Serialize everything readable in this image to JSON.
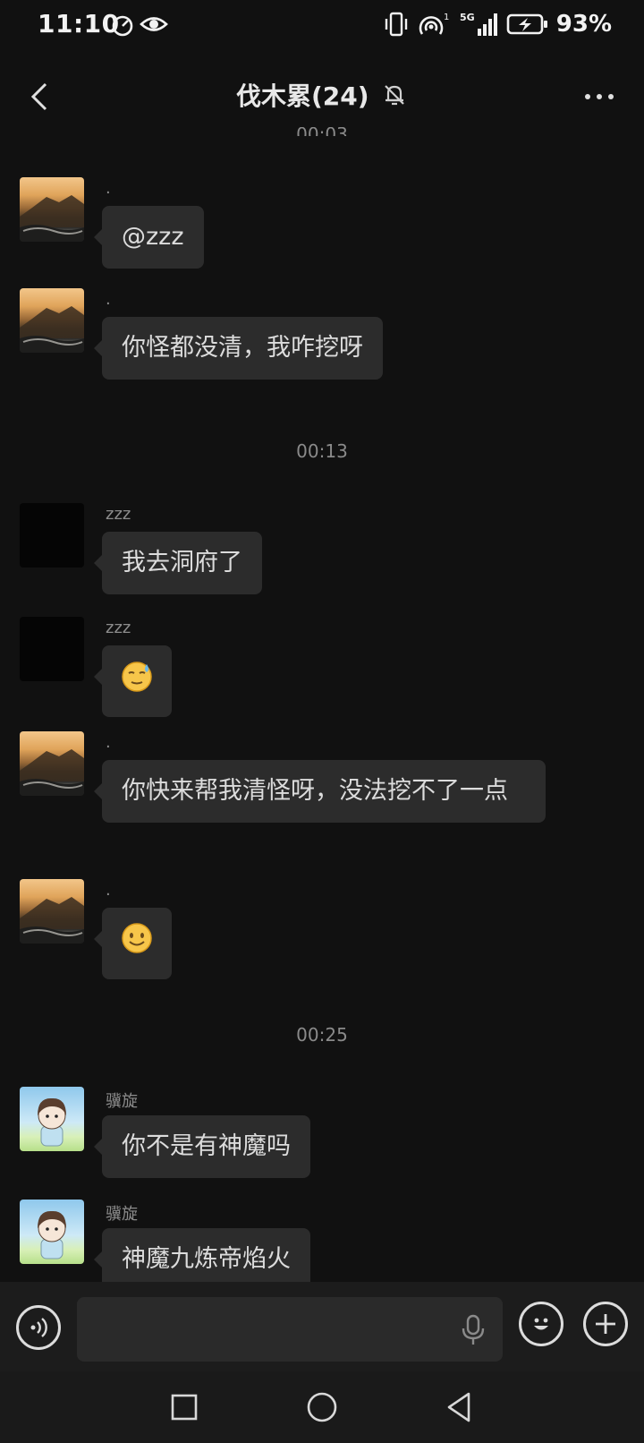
{
  "status_bar": {
    "time": "11:10",
    "network": "5G",
    "sim_label": "1",
    "battery": "93%"
  },
  "header": {
    "title": "伐木累(24)",
    "partial_timestamp": "00:03"
  },
  "messages": [
    {
      "sender": ".",
      "text": "@zzz",
      "avatar": "sunset-avatar"
    },
    {
      "sender": ".",
      "text": "你怪都没清，我咋挖呀",
      "avatar": "sunset-avatar"
    },
    {
      "timestamp": "00:13"
    },
    {
      "sender": "zzz",
      "text": "我去洞府了",
      "avatar": "black-avatar"
    },
    {
      "sender": "zzz",
      "emoji": "sweat-smile-emoji",
      "avatar": "black-avatar"
    },
    {
      "sender": ".",
      "text": "你快来帮我清怪呀，没法挖不了一点",
      "avatar": "sunset-avatar"
    },
    {
      "sender": ".",
      "emoji": "smile-emoji",
      "avatar": "sunset-avatar"
    },
    {
      "timestamp": "00:25"
    },
    {
      "sender": "骥旋",
      "text": "你不是有神魔吗",
      "avatar": "cartoon-avatar"
    },
    {
      "sender": "骥旋",
      "text": "神魔九炼帝焰火",
      "avatar": "cartoon-avatar"
    }
  ],
  "input": {
    "value": "",
    "placeholder": ""
  },
  "colors": {
    "background": "#111111",
    "bubble": "#2c2c2c",
    "input_bar": "#1c1c1c"
  }
}
